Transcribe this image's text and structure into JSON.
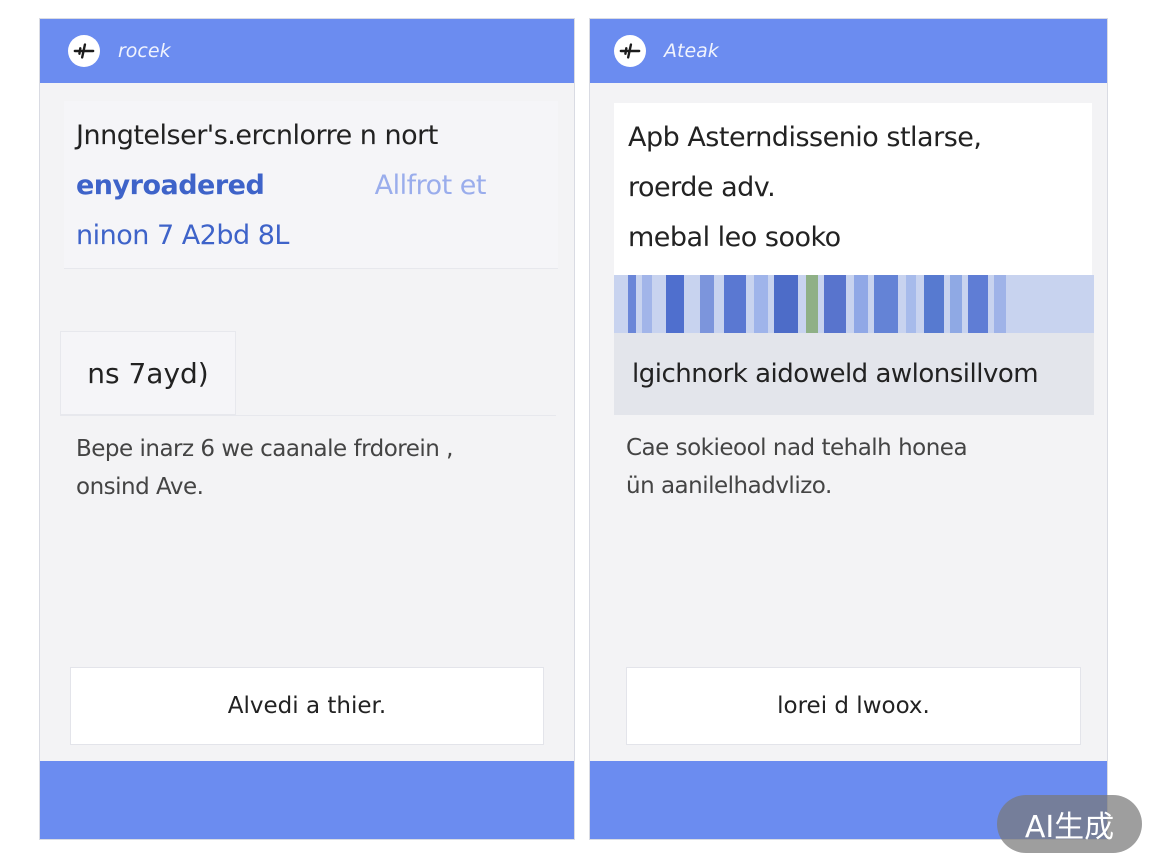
{
  "panels": [
    {
      "title": "rocek",
      "lines": [
        "Jnngtelser's.ercnlorre n nort",
        "enyroadered",
        "Allfrot et",
        "ninon 7 A2bd 8L"
      ],
      "tab_label": "ns 7ayd)",
      "body": [
        "Bepe inarz 6 we caanale frdorein ,",
        "onsind Ave."
      ],
      "button_label": "Alvedi a thier."
    },
    {
      "title": "Ateak",
      "lines": [
        "Apb Asterndissenio stlarse,",
        "roerde adv.",
        "mebal leo sooko"
      ],
      "subtitle": "lgichnork aidoweld awlonsillvom",
      "body": [
        "Cae sokieool nad tehalh honea",
        "ün aanilelhadvlizo."
      ],
      "button_label": "lorei d lwoox."
    }
  ],
  "badge": "AI生成",
  "colors": {
    "header": "#6b8cf0",
    "accent": "#3e63c9"
  },
  "icons": [
    "airplane-icon"
  ]
}
